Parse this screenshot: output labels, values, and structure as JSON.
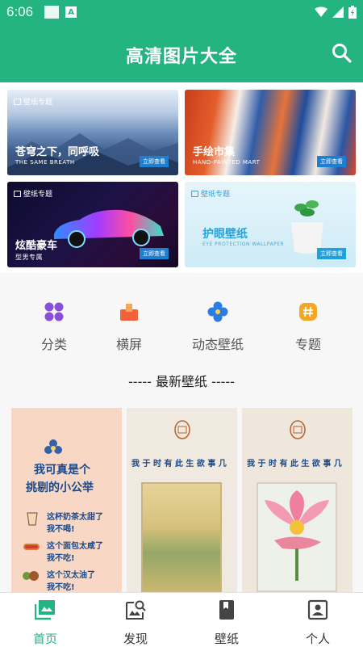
{
  "status_bar": {
    "time": "6:06"
  },
  "app_bar": {
    "title": "高清图片大全",
    "search_icon": "search-icon"
  },
  "banners": [
    {
      "tag": "壁纸专题",
      "title": "苍穹之下，同呼吸",
      "subtitle": "THE SAME BREATH",
      "button": "立即查看"
    },
    {
      "tag": "",
      "title": "手绘市集",
      "subtitle": "HAND-PAINTED MART",
      "button": "立即查看"
    },
    {
      "tag": "壁纸专题",
      "title": "炫酷豪车",
      "subtitle": "型男专属",
      "button": "立即查看"
    },
    {
      "tag": "壁纸专题",
      "title": "护眼壁纸",
      "subtitle": "EYE PROTECTION WALLPAPER",
      "button": "立即查看"
    }
  ],
  "categories": [
    {
      "label": "分类",
      "icon": "grid-icon",
      "color": "#8a4fd8"
    },
    {
      "label": "横屏",
      "icon": "landscape-icon",
      "color": "#f0623a"
    },
    {
      "label": "动态壁纸",
      "icon": "flower-icon",
      "color": "#2a7de1"
    },
    {
      "label": "专题",
      "icon": "hashtag-icon",
      "color": "#f5a623"
    }
  ],
  "section": {
    "title": "----- 最新壁纸 -----"
  },
  "wallpapers": [
    {
      "lines": [
        "我可真是个",
        "挑剔的小公举",
        "这杯奶茶太甜了",
        "我不喝!",
        "这个面包太咸了",
        "我不吃!",
        "这个汉太油了",
        "我不吃!"
      ]
    },
    {
      "lines": [
        "我 于 时 有 此 生 欲 事 几"
      ]
    },
    {
      "lines": [
        "我 于 时 有 此 生 欲 事 几"
      ]
    }
  ],
  "bottom_nav": [
    {
      "label": "首页",
      "icon": "image-gallery-icon",
      "active": true
    },
    {
      "label": "发现",
      "icon": "image-search-icon",
      "active": false
    },
    {
      "label": "壁纸",
      "icon": "book-icon",
      "active": false
    },
    {
      "label": "个人",
      "icon": "person-icon",
      "active": false
    }
  ],
  "colors": {
    "brand": "#23b481",
    "active_tab": "#23b481"
  }
}
